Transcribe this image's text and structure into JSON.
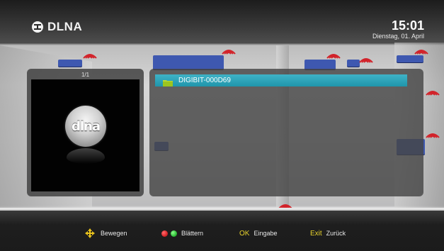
{
  "header": {
    "title": "DLNA",
    "time": "15:01",
    "date": "Dienstag, 01. April"
  },
  "preview": {
    "page_indicator": "1/1",
    "logo_text": "dlna"
  },
  "file_list": {
    "items": [
      {
        "label": "DIGIBIT-000D69",
        "icon": "folder-icon",
        "selected": true
      }
    ]
  },
  "footer": {
    "move_label": "Bewegen",
    "page_label": "Blättern",
    "ok_key": "OK",
    "ok_label": "Eingabe",
    "exit_key": "Exit",
    "exit_label": "Zurück"
  },
  "colors": {
    "highlight": "#2aa3b9",
    "hint_key": "#e8d22c",
    "red_button": "#d8262a",
    "green_button": "#2fbf38"
  }
}
